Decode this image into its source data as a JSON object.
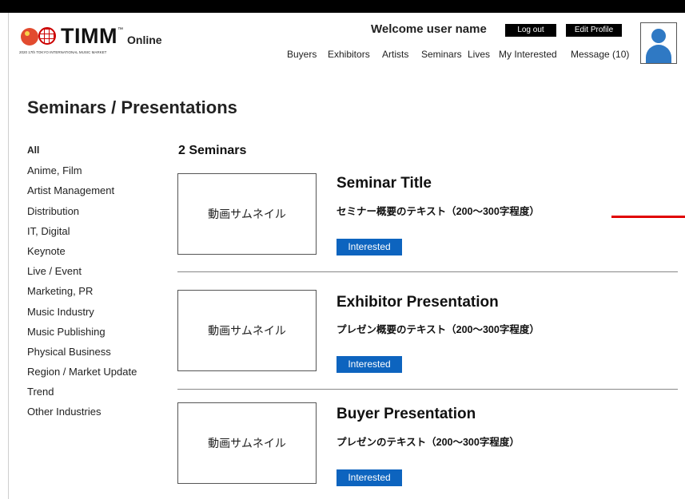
{
  "header": {
    "logo_text": "TIMM",
    "logo_tm": "™",
    "logo_sub": "2020 17th TOKYO INTERNATIONAL MUSIC MARKET",
    "logo_online": "Online",
    "welcome": "Welcome user name",
    "logout_label": "Log out",
    "edit_profile_label": "Edit Profile",
    "nav": [
      "Buyers",
      "Exhibitors",
      "Artists",
      "Seminars",
      "Lives",
      "My Interested",
      "Message (10)"
    ]
  },
  "page_title": "Seminars / Presentations",
  "sidebar": {
    "categories": [
      "All",
      "Anime, Film",
      "Artist Management",
      "Distribution",
      "IT, Digital",
      "Keynote",
      "Live / Event",
      "Marketing, PR",
      "Music Industry",
      "Music Publishing",
      "Physical Business",
      "Region / Market Update",
      "Trend",
      "Other Industries"
    ]
  },
  "main": {
    "count_label": "2 Seminars",
    "items": [
      {
        "thumbnail": "動画サムネイル",
        "title": "Seminar Title",
        "description": "セミナー概要のテキスト（200〜300字程度）",
        "button": "Interested"
      },
      {
        "thumbnail": "動画サムネイル",
        "title": "Exhibitor Presentation",
        "description": "プレゼン概要のテキスト（200〜300字程度）",
        "button": "Interested"
      },
      {
        "thumbnail": "動画サムネイル",
        "title": "Buyer Presentation",
        "description": "プレゼンのテキスト（200〜300字程度）",
        "button": "Interested"
      }
    ]
  },
  "colors": {
    "accent": "#0d64bf",
    "topbar": "#000000",
    "avatar": "#2f79c4",
    "marker": "#e00000"
  }
}
